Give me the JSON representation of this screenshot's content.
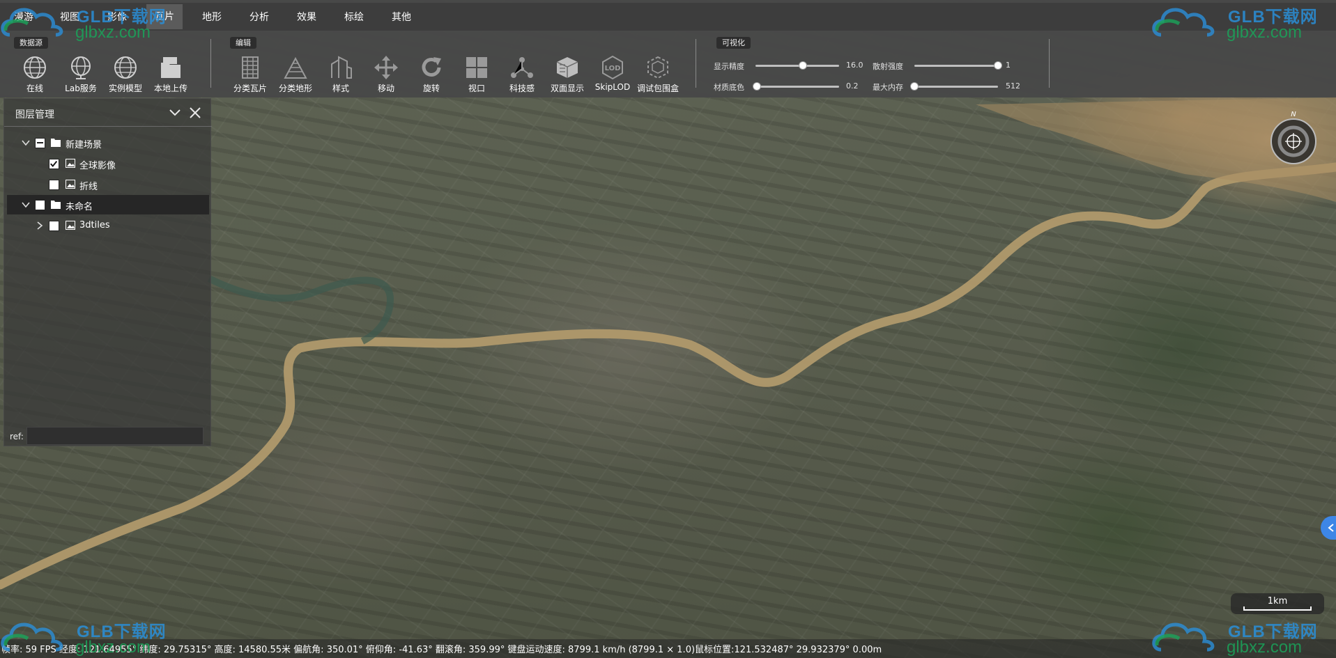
{
  "menu": {
    "items": [
      "漫游",
      "视图",
      "影像",
      "瓦片",
      "地形",
      "分析",
      "效果",
      "标绘",
      "其他"
    ],
    "active": "瓦片"
  },
  "toolbar": {
    "groups": {
      "datasource": "数据源",
      "edit": "编辑",
      "visualize": "可视化"
    },
    "datasource_tools": [
      "在线",
      "Lab服务",
      "实例模型",
      "本地上传"
    ],
    "edit_tools": [
      "分类瓦片",
      "分类地形",
      "样式",
      "移动",
      "旋转",
      "视口",
      "科技感",
      "双面显示",
      "SkipLOD",
      "调试包围盒"
    ],
    "sliders": {
      "precision": {
        "label": "显示精度",
        "value": "16.0",
        "level": 0.57
      },
      "scatter": {
        "label": "散射强度",
        "value": "1",
        "level": 1.0
      },
      "base_color": {
        "label": "材质底色",
        "value": "0.2",
        "level": 0.02
      },
      "max_memory": {
        "label": "最大内存",
        "value": "512",
        "level": 0.0
      }
    }
  },
  "layer_panel": {
    "title": "图层管理",
    "tree": [
      {
        "label": "新建场景",
        "type": "folder",
        "checked": "partial",
        "expanded": true
      },
      {
        "label": "全球影像",
        "type": "layer",
        "checked": true
      },
      {
        "label": "折线",
        "type": "layer",
        "checked": false
      },
      {
        "label": "未命名",
        "type": "folder",
        "checked": false,
        "expanded": true,
        "selected": true
      },
      {
        "label": "3dtiles",
        "type": "layer",
        "checked": false,
        "expanded": false
      }
    ],
    "ref_label": "ref:",
    "ref_value": ""
  },
  "compass": {
    "north": "N"
  },
  "scale": {
    "label": "1km"
  },
  "status_bar": {
    "text": "帧率: 59 FPS 经度: 121.64955° 纬度: 29.75315° 高度: 14580.55米 偏航角: 350.01° 俯仰角: -41.63° 翻滚角: 359.99° 键盘运动速度: 8799.1 km/h (8799.1 × 1.0)鼠标位置:121.532487° 29.932379° 0.00m"
  },
  "watermark": {
    "brand": "GLB下载网",
    "site": "glbxz.com",
    "logo": "GLB"
  },
  "colors": {
    "menu_bg": "#3d3d3d",
    "toolbar_bg": "#484848",
    "panel_bg": "#373737",
    "river": "#b29a6e",
    "handle": "#3d86e6"
  }
}
